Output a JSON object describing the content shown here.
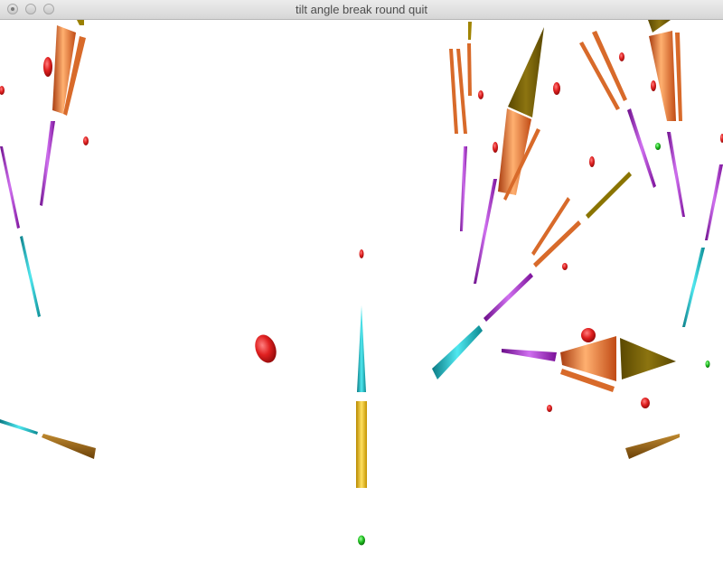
{
  "window": {
    "title": "tilt angle break round quit"
  },
  "colors": {
    "background": "#ffffff",
    "orange": "#e86f2c",
    "gold": "#7a6400",
    "yellow": "#f0c020",
    "magenta": "#a020c0",
    "cyan": "#18b8c0",
    "red": "#d82020",
    "green": "#20c020",
    "bronze": "#9a6418"
  }
}
